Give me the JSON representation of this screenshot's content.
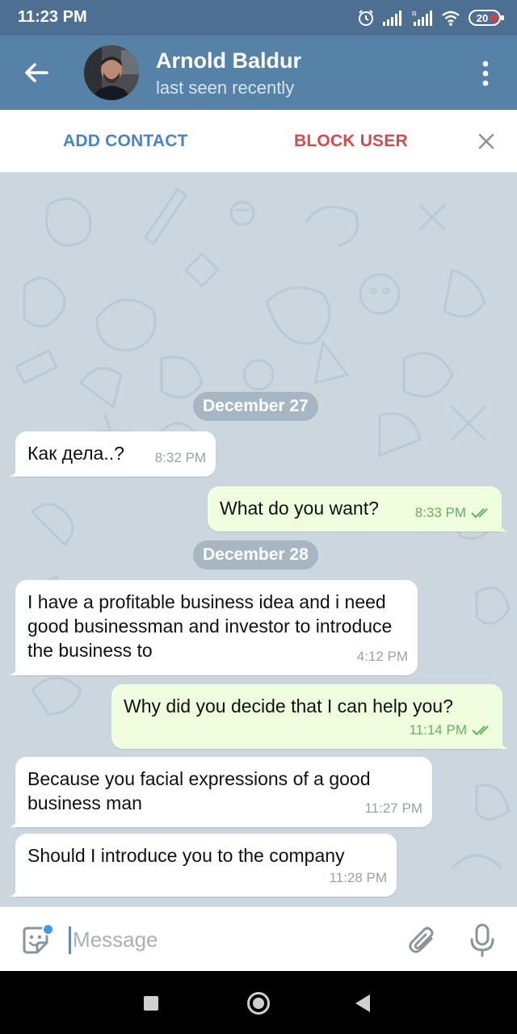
{
  "status_bar": {
    "time": "11:23 PM",
    "battery": "20",
    "icons": [
      "alarm-icon",
      "signal-icon",
      "signal-r-icon",
      "wifi-icon",
      "battery-icon"
    ]
  },
  "header": {
    "contact_name": "Arnold Baldur",
    "status": "last seen recently",
    "back_icon": "arrow-left-icon",
    "menu_icon": "more-vertical-icon"
  },
  "actions": {
    "add_contact": "ADD CONTACT",
    "block_user": "BLOCK USER",
    "close_icon": "close-icon"
  },
  "chat": {
    "items": [
      {
        "type": "date",
        "text": "December 27"
      },
      {
        "type": "msg",
        "direction": "in",
        "text": "Как дела..?",
        "time": "8:32 PM"
      },
      {
        "type": "msg",
        "direction": "out",
        "text": "What do you want?",
        "time": "8:33 PM",
        "read": true
      },
      {
        "type": "date",
        "text": "December 28"
      },
      {
        "type": "msg",
        "direction": "in",
        "text": "I have a profitable business idea and i need good businessman and investor to introduce the business to",
        "time": "4:12 PM"
      },
      {
        "type": "msg",
        "direction": "out",
        "text": "Why did you decide that I can help you?",
        "time": "11:14 PM",
        "read": true
      },
      {
        "type": "msg",
        "direction": "in",
        "text": "Because you facial expressions of a good business man",
        "time": "11:27 PM"
      },
      {
        "type": "msg",
        "direction": "in",
        "text": "Should I introduce you to the company",
        "time": "11:28 PM"
      }
    ]
  },
  "input": {
    "placeholder": "Message",
    "value": "",
    "sticker_icon": "sticker-icon",
    "attach_icon": "paperclip-icon",
    "mic_icon": "microphone-icon"
  },
  "nav": {
    "icons": [
      "recents-icon",
      "home-icon",
      "back-icon"
    ]
  },
  "colors": {
    "header": "#5682a8",
    "status_bar": "#4d6f92",
    "chat_bg": "#ccd6de",
    "outgoing_bubble": "#effedd",
    "incoming_bubble": "#ffffff",
    "add_contact": "#4a86bd",
    "block_user": "#d14c4c",
    "read_check": "#5fb462"
  }
}
